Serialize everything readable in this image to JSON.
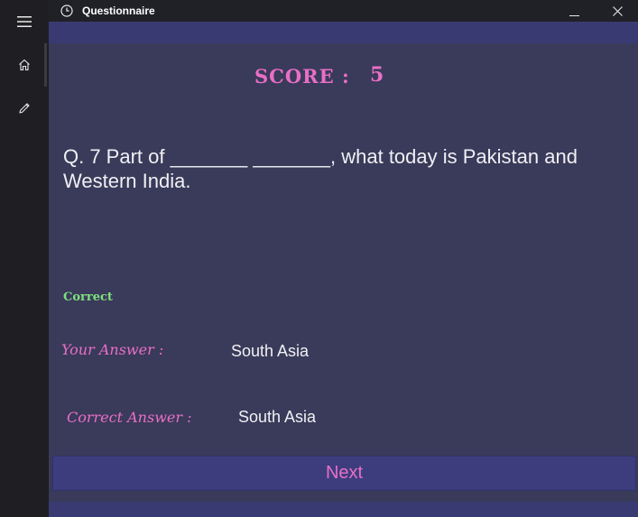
{
  "window": {
    "title": "Questionnaire",
    "icons": {
      "app": "clock-icon",
      "minimize": "minimize-icon",
      "close": "close-icon"
    }
  },
  "nav": {
    "items": [
      {
        "name": "menu",
        "icon": "hamburger-menu-icon"
      },
      {
        "name": "home",
        "icon": "home-icon"
      },
      {
        "name": "edit",
        "icon": "pencil-icon"
      }
    ]
  },
  "quiz": {
    "score_label": "SCORE :",
    "score_value": "5",
    "question": "Q. 7  Part of _______ _______, what today is Pakistan and Western India.",
    "result": "Correct",
    "your_answer_label": "Your Answer :",
    "your_answer_value": "South Asia",
    "correct_answer_label": "Correct Answer :",
    "correct_answer_value": "South Asia",
    "next_label": "Next"
  },
  "colors": {
    "accent_pink": "#e96fc6",
    "correct_green": "#7ee07e",
    "content_bg": "#3a3a5a",
    "band_bg": "#3a3a72"
  }
}
